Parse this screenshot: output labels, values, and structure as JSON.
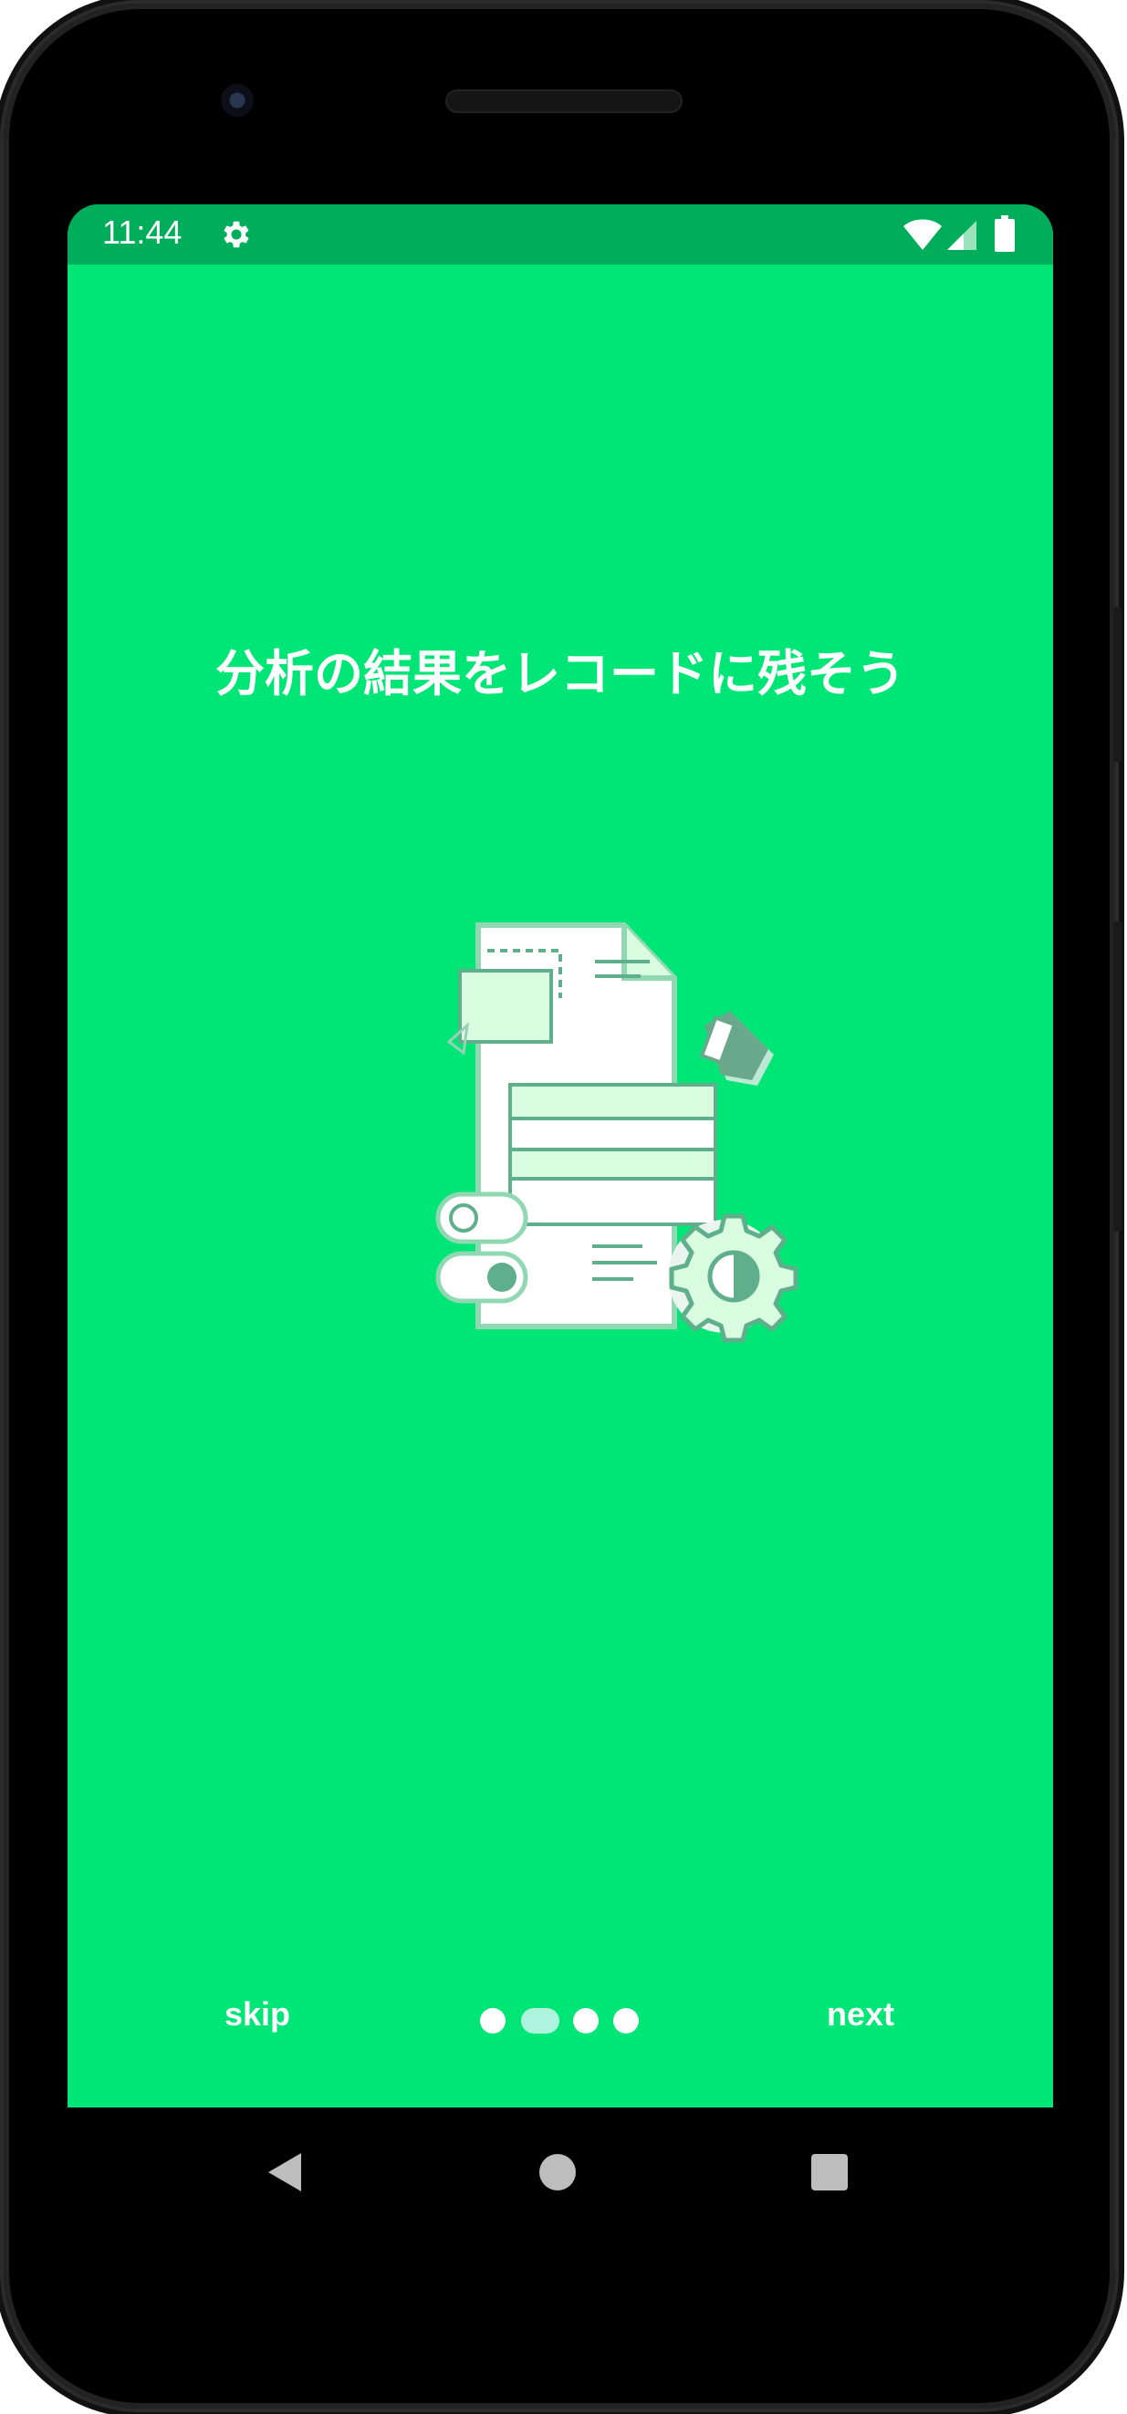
{
  "status_bar": {
    "time": "11:44",
    "icons": [
      "gear-icon",
      "wifi-icon",
      "signal-icon",
      "battery-icon"
    ]
  },
  "onboarding": {
    "title": "分析の結果をレコードに残そう",
    "illustration": "document-settings-illustration",
    "skip_label": "skip",
    "next_label": "next",
    "page_indicator": {
      "total": 4,
      "current": 2
    }
  },
  "nav_bar": {
    "icons": [
      "back-icon",
      "home-icon",
      "recents-icon"
    ]
  },
  "colors": {
    "background": "#00e676",
    "status_bar": "#00ad5b",
    "illustration_stroke": "#5fae8c",
    "illustration_fill": "#d9fbe0",
    "active_dot": "#aef3dd"
  }
}
